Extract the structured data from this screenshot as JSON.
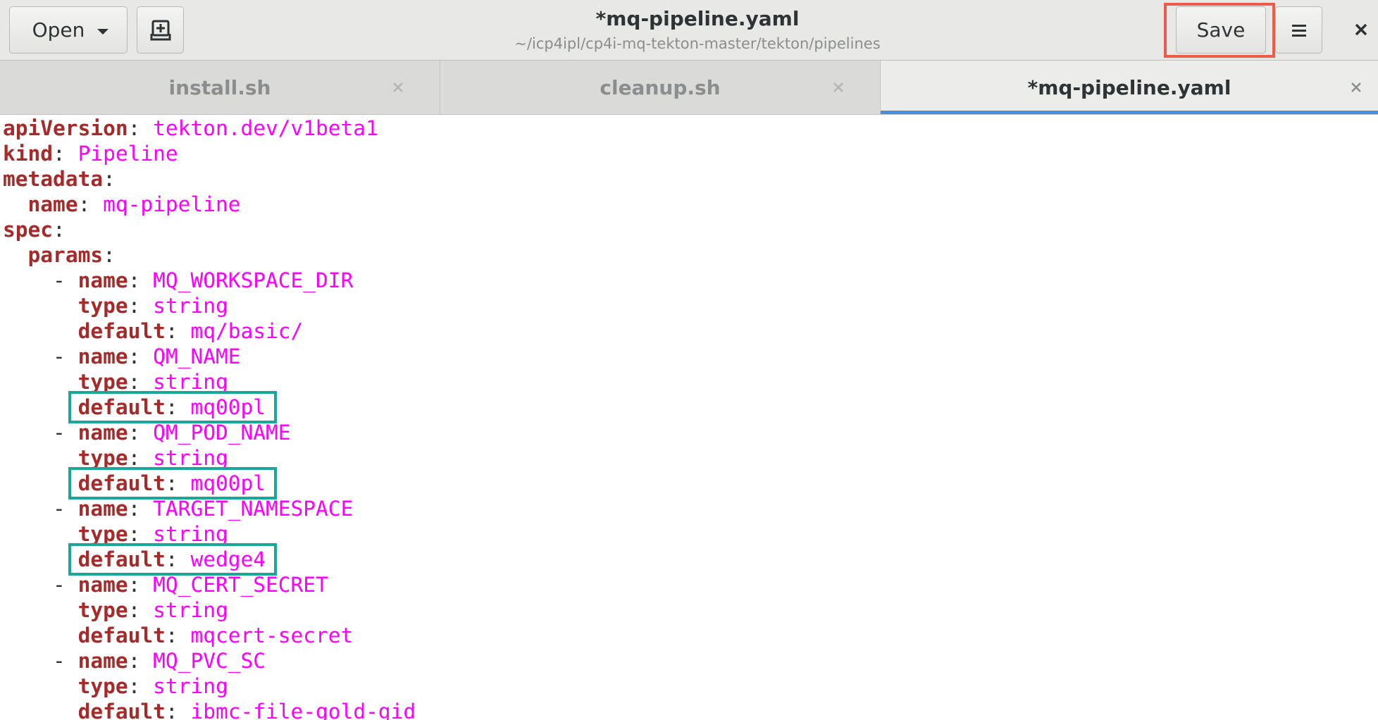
{
  "header": {
    "open_label": "Open",
    "save_label": "Save",
    "title": "*mq-pipeline.yaml",
    "path": "~/icp4ipl/cp4i-mq-tekton-master/tekton/pipelines",
    "icons": {
      "open_menu": "chevron-down-icon",
      "new_document": "new-document-icon",
      "menu": "hamburger-menu-icon",
      "close_window": "close-icon"
    },
    "save_highlight_color": "#f05a4a"
  },
  "tabs": [
    {
      "label": "install.sh",
      "active": false
    },
    {
      "label": "cleanup.sh",
      "active": false
    },
    {
      "label": "*mq-pipeline.yaml",
      "active": true
    }
  ],
  "editor": {
    "colors": {
      "key": "#a52a2a",
      "value": "#ff00ff",
      "punctuation": "#2e3436",
      "highlight_box": "#17a89a",
      "active_tab_underline": "#4a90d9"
    },
    "lines": [
      {
        "indent": "",
        "dash": "",
        "key": "apiVersion",
        "value": "tekton.dev/v1beta1"
      },
      {
        "indent": "",
        "dash": "",
        "key": "kind",
        "value": "Pipeline"
      },
      {
        "indent": "",
        "dash": "",
        "key": "metadata",
        "value": ""
      },
      {
        "indent": "  ",
        "dash": "",
        "key": "name",
        "value": "mq-pipeline"
      },
      {
        "indent": "",
        "dash": "",
        "key": "spec",
        "value": ""
      },
      {
        "indent": "  ",
        "dash": "",
        "key": "params",
        "value": ""
      },
      {
        "indent": "    ",
        "dash": "- ",
        "key": "name",
        "value": "MQ_WORKSPACE_DIR"
      },
      {
        "indent": "      ",
        "dash": "",
        "key": "type",
        "value": "string"
      },
      {
        "indent": "      ",
        "dash": "",
        "key": "default",
        "value": "mq/basic/"
      },
      {
        "indent": "    ",
        "dash": "- ",
        "key": "name",
        "value": "QM_NAME"
      },
      {
        "indent": "      ",
        "dash": "",
        "key": "type",
        "value": "string"
      },
      {
        "indent": "      ",
        "dash": "",
        "key": "default",
        "value": "mq00pl",
        "highlighted": true
      },
      {
        "indent": "    ",
        "dash": "- ",
        "key": "name",
        "value": "QM_POD_NAME"
      },
      {
        "indent": "      ",
        "dash": "",
        "key": "type",
        "value": "string"
      },
      {
        "indent": "      ",
        "dash": "",
        "key": "default",
        "value": "mq00pl",
        "highlighted": true
      },
      {
        "indent": "    ",
        "dash": "- ",
        "key": "name",
        "value": "TARGET_NAMESPACE"
      },
      {
        "indent": "      ",
        "dash": "",
        "key": "type",
        "value": "string"
      },
      {
        "indent": "      ",
        "dash": "",
        "key": "default",
        "value": "wedge4",
        "highlighted": true
      },
      {
        "indent": "    ",
        "dash": "- ",
        "key": "name",
        "value": "MQ_CERT_SECRET"
      },
      {
        "indent": "      ",
        "dash": "",
        "key": "type",
        "value": "string"
      },
      {
        "indent": "      ",
        "dash": "",
        "key": "default",
        "value": "mqcert-secret"
      },
      {
        "indent": "    ",
        "dash": "- ",
        "key": "name",
        "value": "MQ_PVC_SC"
      },
      {
        "indent": "      ",
        "dash": "",
        "key": "type",
        "value": "string"
      },
      {
        "indent": "      ",
        "dash": "",
        "key": "default",
        "value": "ibmc-file-gold-gid"
      }
    ]
  }
}
